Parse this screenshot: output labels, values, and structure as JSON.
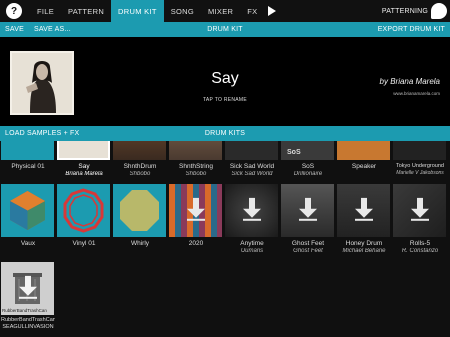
{
  "nav": {
    "help": "?",
    "tabs": [
      "FILE",
      "PATTERN",
      "DRUM KIT",
      "SONG",
      "MIXER",
      "FX"
    ],
    "active_tab": "DRUM KIT",
    "app_name": "PATTERNING"
  },
  "toolbar": {
    "save": "SAVE",
    "save_as": "SAVE AS...",
    "title": "DRUM KIT",
    "export": "EXPORT DRUM KIT"
  },
  "kit": {
    "name": "Say",
    "tap_hint": "TAP TO RENAME",
    "author": "by Briana Marela",
    "website": "www.brianamarela.com"
  },
  "kits_bar": {
    "load": "LOAD SAMPLES + FX",
    "title": "DRUM KITS"
  },
  "rows": [
    [
      {
        "name": "Physical 01",
        "author": ""
      },
      {
        "name": "Say",
        "author": "Briana Marela",
        "selected": true
      },
      {
        "name": "ShnthDrum",
        "author": "Shbobo"
      },
      {
        "name": "ShnthString",
        "author": "Shbobo"
      },
      {
        "name": "Sick Sad World",
        "author": "Sick Sad World"
      },
      {
        "name": "SoS",
        "author": "Drillionaire"
      },
      {
        "name": "Speaker",
        "author": ""
      },
      {
        "name": "Tokyo Underground",
        "author": "Marielle V Jakobsons"
      }
    ],
    [
      {
        "name": "Vaux",
        "author": ""
      },
      {
        "name": "Vinyl 01",
        "author": ""
      },
      {
        "name": "Whirly",
        "author": ""
      },
      {
        "name": "2020",
        "author": ""
      },
      {
        "name": "Anytime",
        "author": "Uumans"
      },
      {
        "name": "Ghost Feet",
        "author": "Ghost Feet"
      },
      {
        "name": "Honey Drum",
        "author": "Michael Beharie"
      },
      {
        "name": "Rolls-5",
        "author": "R. Constanzo"
      }
    ],
    [
      {
        "name": "RubberBandTrashCan",
        "author": "SEAGULLINVASION",
        "thumb_label": "RubberBandTrashCan"
      }
    ]
  ],
  "colors": {
    "accent": "#1c9bb0",
    "background": "#101010"
  }
}
